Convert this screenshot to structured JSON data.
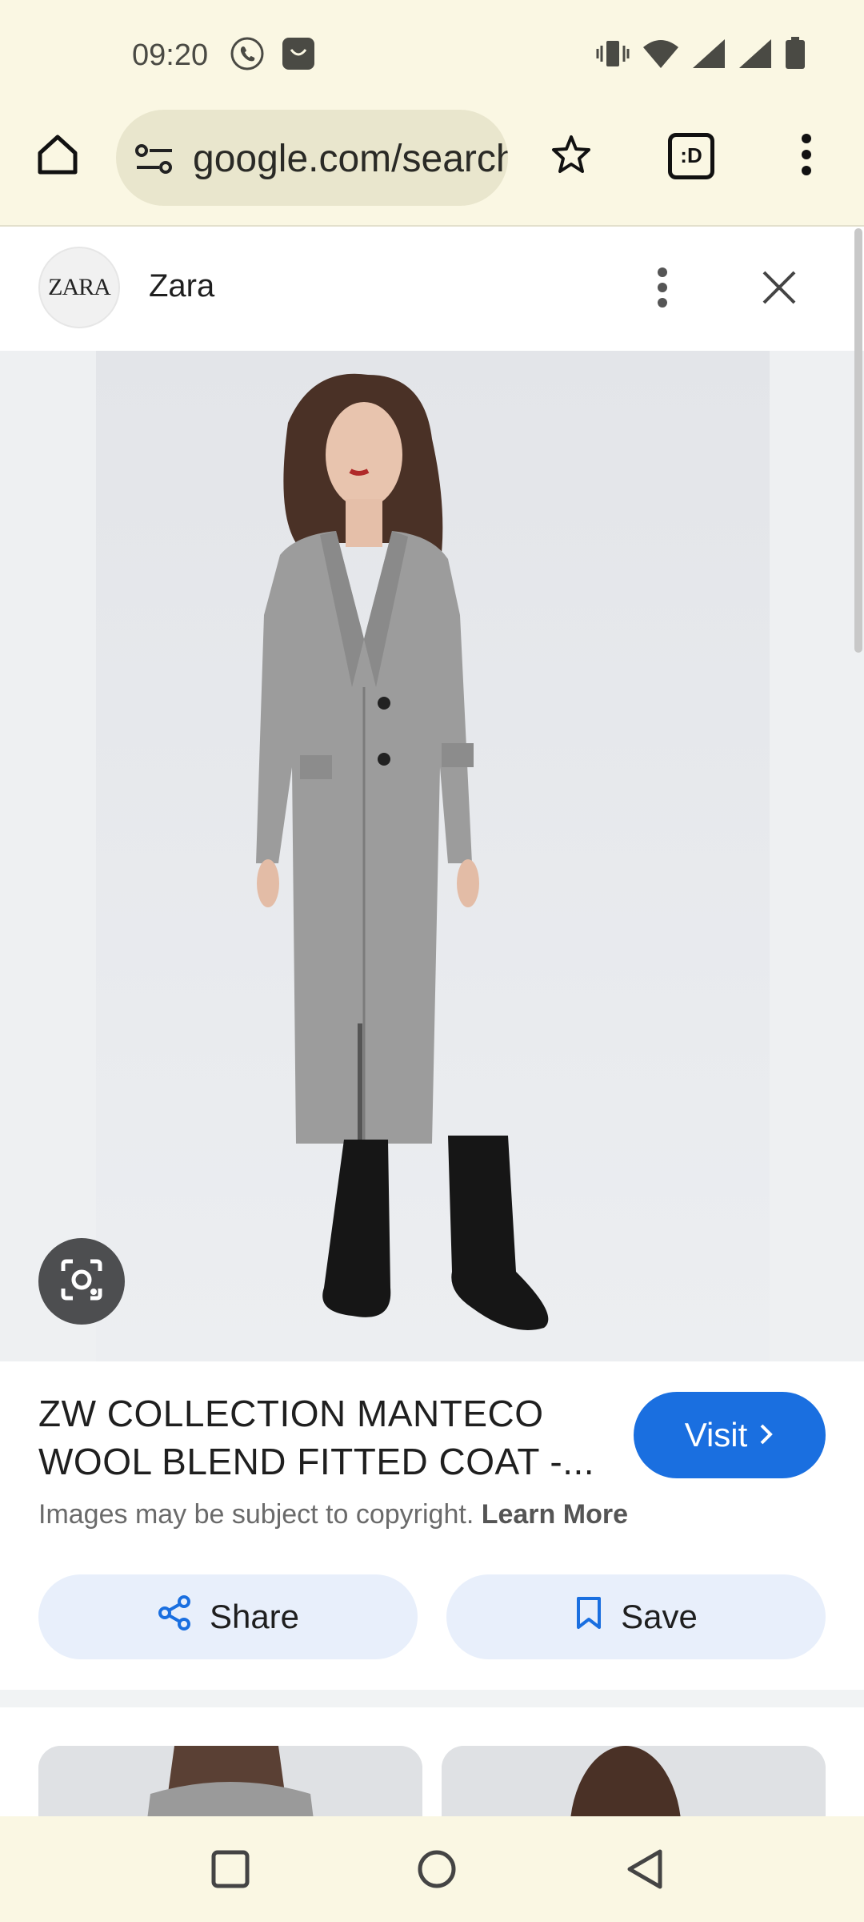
{
  "status_bar": {
    "time": "09:20",
    "icons": [
      "viber-icon",
      "store-icon",
      "vibrate-icon",
      "wifi-icon",
      "signal-icon",
      "signal-icon",
      "battery-icon"
    ]
  },
  "toolbar": {
    "url": "google.com/search",
    "icons": [
      "home-icon",
      "site-settings-icon",
      "bookmark-star-icon",
      "tab-switcher-icon",
      "more-vert-icon"
    ],
    "tab_switcher_label": ":D"
  },
  "panel": {
    "logo_text": "ZARA",
    "site_name": "Zara"
  },
  "result": {
    "title": "ZW COLLECTION MANTECO WOOL BLEND FITTED COAT -...",
    "visit_label": "Visit",
    "copyright_text": "Images may be subject to copyright.",
    "learn_more": "Learn More",
    "share_label": "Share",
    "save_label": "Save"
  },
  "colors": {
    "chrome_bg": "#faf7e3",
    "accent_blue": "#1a6fe0",
    "button_tint": "#e8effb"
  }
}
